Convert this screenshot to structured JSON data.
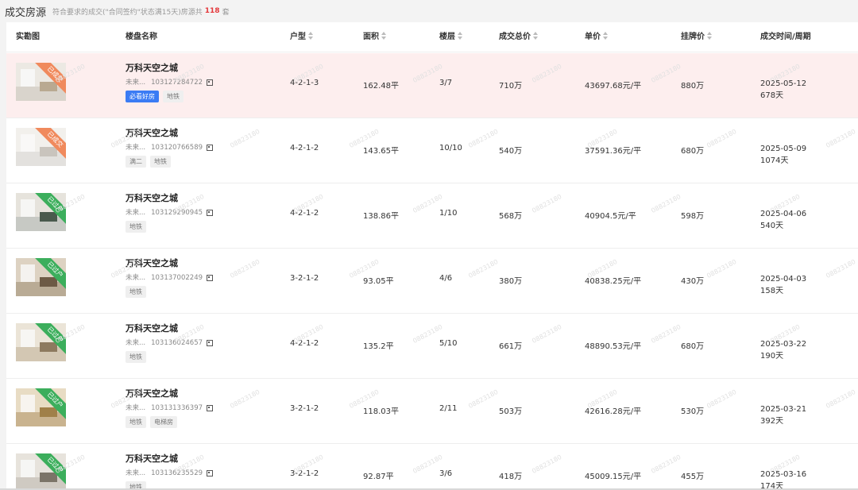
{
  "header": {
    "title": "成交房源",
    "subtitle": "符合要求的成交(\"合同签约\"状态满15天)房源共",
    "count": "118",
    "unit": "套"
  },
  "columns": {
    "photo": "实勘图",
    "name": "楼盘名称",
    "layout": "户型",
    "area": "面积",
    "floor": "楼层",
    "total": "成交总价",
    "unit_price": "单价",
    "list_price": "挂牌价",
    "deal_time": "成交时间/周期"
  },
  "watermark": "08823180",
  "listings": [
    {
      "ribbon": "已成交",
      "ribbon_color": "#f08a5d",
      "name": "万科天空之城",
      "area_short": "未来...",
      "id": "103127284722",
      "tags": [
        "必看好房",
        "地铁"
      ],
      "layout": "4-2-1-3",
      "size": "162.48平",
      "floor": "3/7",
      "total": "710万",
      "unit_price": "43697.68元/平",
      "list_price": "880万",
      "date": "2025-05-12",
      "cycle": "678天"
    },
    {
      "ribbon": "已成交",
      "ribbon_color": "#f08a5d",
      "name": "万科天空之城",
      "area_short": "未来...",
      "id": "103120766589",
      "tags": [
        "满二",
        "地铁"
      ],
      "layout": "4-2-1-2",
      "size": "143.65平",
      "floor": "10/10",
      "total": "540万",
      "unit_price": "37591.36元/平",
      "list_price": "680万",
      "date": "2025-05-09",
      "cycle": "1074天"
    },
    {
      "ribbon": "已过户",
      "ribbon_color": "#3cae5c",
      "name": "万科天空之城",
      "area_short": "未来...",
      "id": "103129290945",
      "tags": [
        "地铁"
      ],
      "layout": "4-2-1-2",
      "size": "138.86平",
      "floor": "1/10",
      "total": "568万",
      "unit_price": "40904.5元/平",
      "list_price": "598万",
      "date": "2025-04-06",
      "cycle": "540天"
    },
    {
      "ribbon": "已过户",
      "ribbon_color": "#3cae5c",
      "name": "万科天空之城",
      "area_short": "未来...",
      "id": "103137002249",
      "tags": [
        "地铁"
      ],
      "layout": "3-2-1-2",
      "size": "93.05平",
      "floor": "4/6",
      "total": "380万",
      "unit_price": "40838.25元/平",
      "list_price": "430万",
      "date": "2025-04-03",
      "cycle": "158天"
    },
    {
      "ribbon": "已过户",
      "ribbon_color": "#3cae5c",
      "name": "万科天空之城",
      "area_short": "未来...",
      "id": "103136024657",
      "tags": [
        "地铁"
      ],
      "layout": "4-2-1-2",
      "size": "135.2平",
      "floor": "5/10",
      "total": "661万",
      "unit_price": "48890.53元/平",
      "list_price": "680万",
      "date": "2025-03-22",
      "cycle": "190天"
    },
    {
      "ribbon": "已过户",
      "ribbon_color": "#3cae5c",
      "name": "万科天空之城",
      "area_short": "未来...",
      "id": "103131336397",
      "tags": [
        "地铁",
        "电梯房"
      ],
      "layout": "3-2-1-2",
      "size": "118.03平",
      "floor": "2/11",
      "total": "503万",
      "unit_price": "42616.28元/平",
      "list_price": "530万",
      "date": "2025-03-21",
      "cycle": "392天"
    },
    {
      "ribbon": "已过户",
      "ribbon_color": "#3cae5c",
      "name": "万科天空之城",
      "area_short": "未来...",
      "id": "103136235529",
      "tags": [
        "地铁"
      ],
      "layout": "3-2-1-2",
      "size": "92.87平",
      "floor": "3/6",
      "total": "418万",
      "unit_price": "45009.15元/平",
      "list_price": "455万",
      "date": "2025-03-16",
      "cycle": "174天"
    }
  ]
}
